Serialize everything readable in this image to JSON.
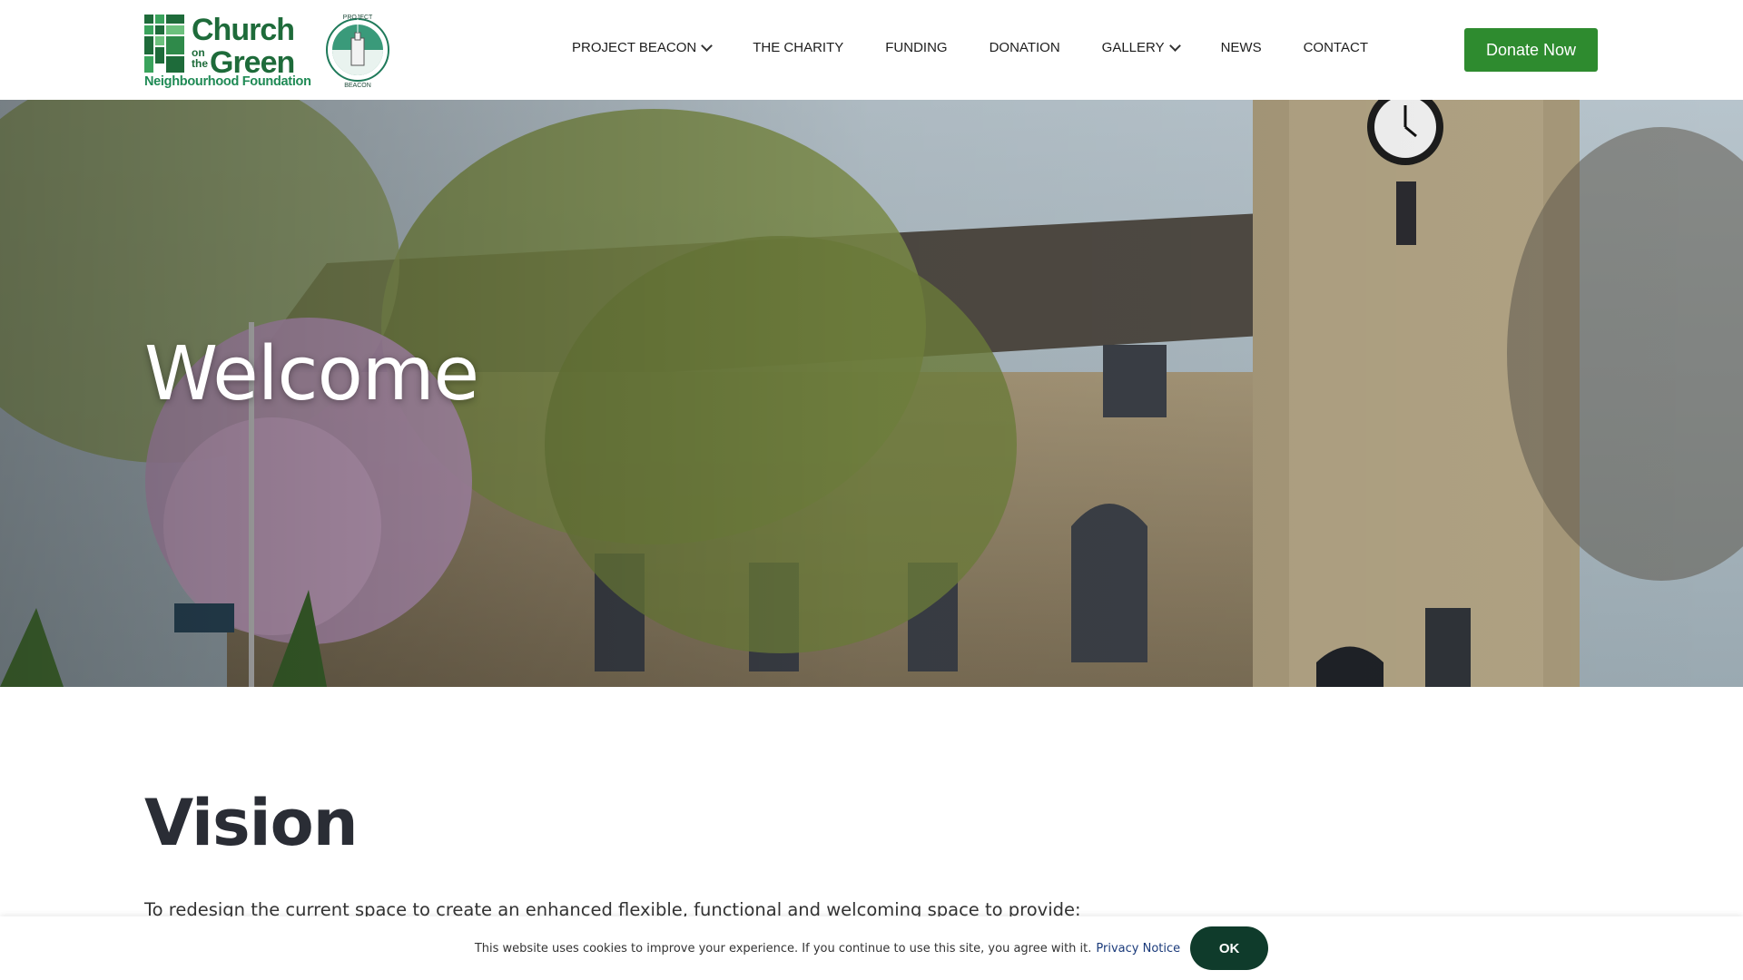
{
  "header": {
    "logo": {
      "church": "Church",
      "on_the": "on the",
      "green": "Green",
      "foundation": "Neighbourhood Foundation",
      "beacon_top": "PROJECT",
      "beacon_bottom": "BEACON"
    },
    "nav": [
      {
        "label": "PROJECT BEACON",
        "has_dropdown": true
      },
      {
        "label": "THE CHARITY",
        "has_dropdown": false
      },
      {
        "label": "FUNDING",
        "has_dropdown": false
      },
      {
        "label": "DONATION",
        "has_dropdown": false
      },
      {
        "label": "GALLERY",
        "has_dropdown": true
      },
      {
        "label": "NEWS",
        "has_dropdown": false
      },
      {
        "label": "CONTACT",
        "has_dropdown": false
      }
    ],
    "donate_label": "Donate Now"
  },
  "hero": {
    "title": "Welcome"
  },
  "vision": {
    "title": "Vision",
    "text": "To redesign the current space to create an enhanced flexible, functional and welcoming space to provide:"
  },
  "cookie": {
    "text": "This website uses cookies to improve your experience. If you continue to use this site, you agree with it.",
    "link": "Privacy Notice",
    "ok": "OK"
  },
  "colors": {
    "brand_green": "#1e6b3a",
    "donate_green": "#2e8b2f",
    "ok_button": "#0f3b2b"
  }
}
